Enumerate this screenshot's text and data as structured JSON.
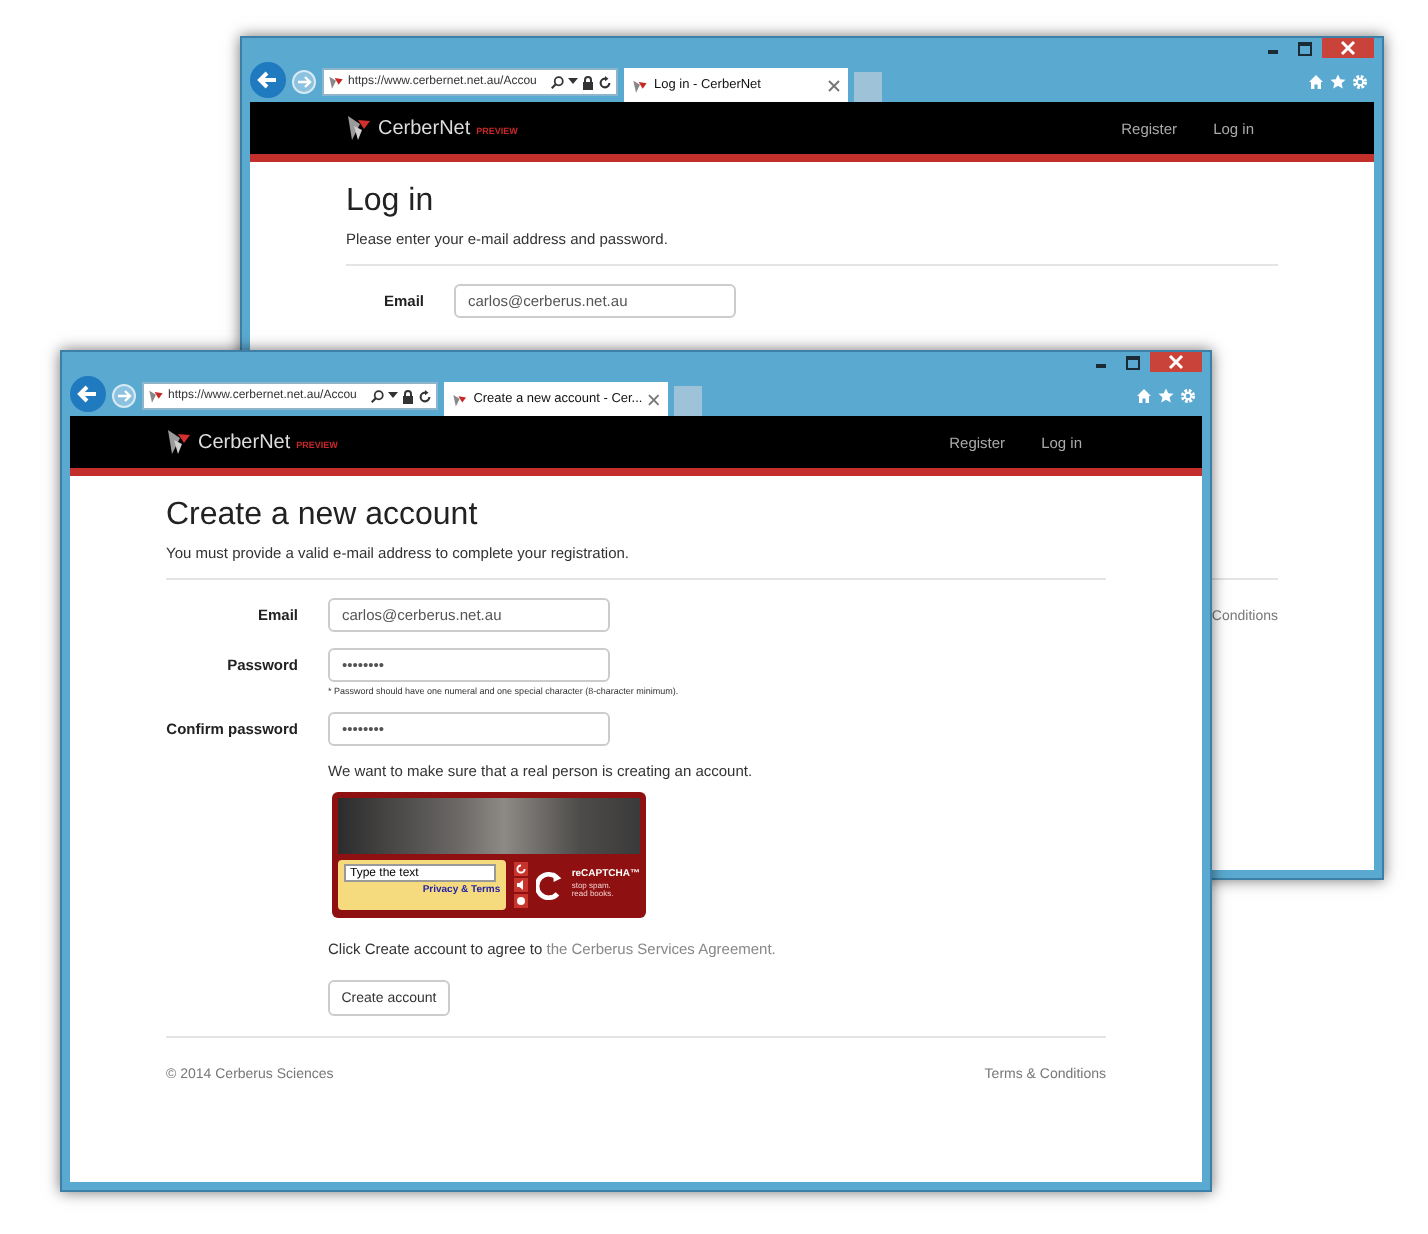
{
  "windows": [
    {
      "kind": "login",
      "browser": {
        "url": "https://www.cerbernet.net.au/Accou",
        "tab_title": "Log in - CerberNet"
      },
      "nav": {
        "brand": "CerberNet",
        "badge": "PREVIEW",
        "links": [
          "Register",
          "Log in"
        ]
      },
      "heading": "Log in",
      "subtitle": "Please enter your e-mail address and password.",
      "fields": [
        {
          "label": "Email",
          "value": "carlos@cerberus.net.au"
        }
      ],
      "footer": {
        "link": "Conditions"
      }
    },
    {
      "kind": "register",
      "browser": {
        "url": "https://www.cerbernet.net.au/Accou",
        "tab_title": "Create a new account - Cer..."
      },
      "nav": {
        "brand": "CerberNet",
        "badge": "PREVIEW",
        "links": [
          "Register",
          "Log in"
        ]
      },
      "heading": "Create a new account",
      "subtitle": "You must provide a valid e-mail address to complete your registration.",
      "fields": [
        {
          "label": "Email",
          "value": "carlos@cerberus.net.au"
        },
        {
          "label": "Password",
          "value": "••••••••",
          "hint": "* Password should have one numeral and one special character (8-character minimum)."
        },
        {
          "label": "Confirm password",
          "value": "••••••••"
        }
      ],
      "captcha": {
        "intro": "We want to make sure that a real person is creating an account.",
        "placeholder": "Type the text",
        "link": "Privacy & Terms",
        "brand": "reCAPTCHA™",
        "tagline": "stop spam. read books."
      },
      "agreement": {
        "text": "Click Create account to agree to",
        "link": "the Cerberus Services Agreement."
      },
      "submit": "Create account",
      "footer": {
        "copyright": "© 2014 Cerberus Sciences",
        "link": "Terms & Conditions"
      }
    }
  ]
}
